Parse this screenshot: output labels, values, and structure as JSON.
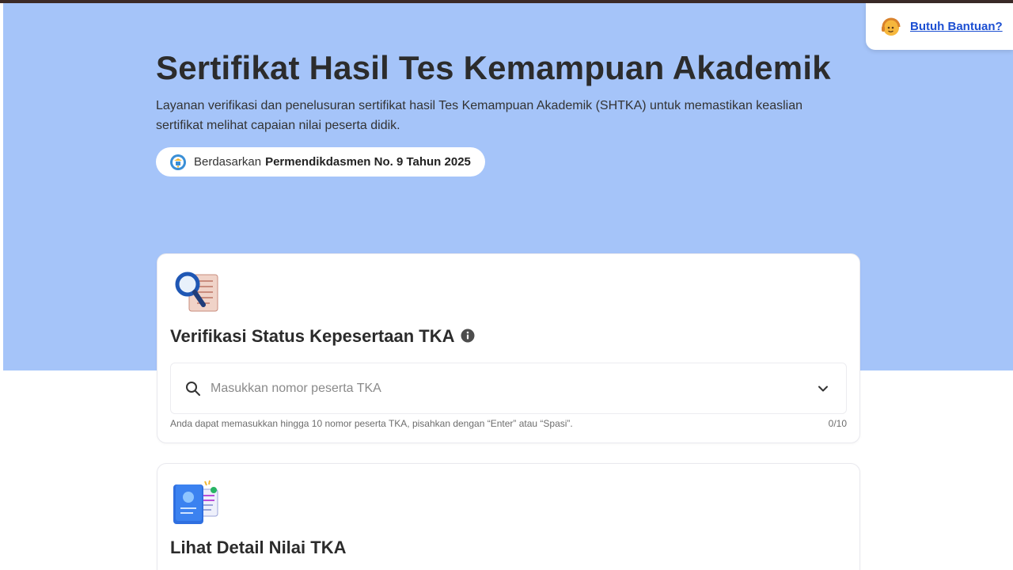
{
  "header": {
    "help_label": "Butuh Bantuan?"
  },
  "hero": {
    "title": "Sertifikat Hasil Tes Kemampuan Akademik",
    "description": "Layanan verifikasi dan penelusuran sertifikat hasil Tes Kemampuan Akademik (SHTKA) untuk memastikan keaslian sertifikat melihat capaian nilai peserta didik.",
    "regulation_prefix": "Berdasarkan",
    "regulation_name": "Permendikdasmen No. 9 Tahun 2025"
  },
  "verify_card": {
    "title": "Verifikasi Status Kepesertaan TKA",
    "search": {
      "placeholder": "Masukkan nomor peserta TKA",
      "value": ""
    },
    "hint": "Anda dapat memasukkan hingga 10 nomor peserta TKA, pisahkan dengan “Enter” atau “Spasi”.",
    "counter": "0/10"
  },
  "detail_card": {
    "title": "Lihat Detail Nilai TKA"
  },
  "colors": {
    "hero_background": "#a5c4f9",
    "link": "#1c4fd2",
    "top_strip": "#3a2a28"
  },
  "icons": {
    "help": "customer-support-icon",
    "regulation": "kemendikdasmen-logo",
    "verify": "magnifier-document-icon",
    "info": "info-icon",
    "search": "search-icon",
    "dropdown": "chevron-down-icon",
    "detail": "score-book-icon"
  }
}
